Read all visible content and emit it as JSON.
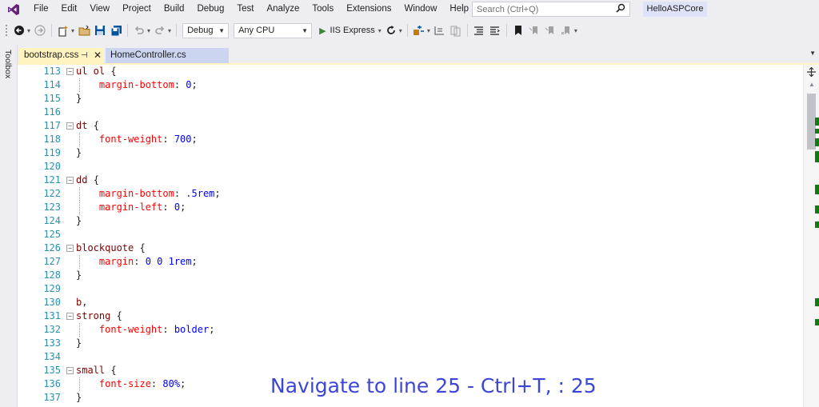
{
  "menu": {
    "items": [
      "File",
      "Edit",
      "View",
      "Project",
      "Build",
      "Debug",
      "Test",
      "Analyze",
      "Tools",
      "Extensions",
      "Window",
      "Help"
    ],
    "search_placeholder": "Search (Ctrl+Q)",
    "solution_name": "HelloASPCore"
  },
  "toolbar": {
    "config": "Debug",
    "platform": "Any CPU",
    "run_label": "IIS Express"
  },
  "toolbox": {
    "label": "Toolbox"
  },
  "tabs": [
    {
      "label": "bootstrap.css",
      "active": true
    },
    {
      "label": "HomeController.cs",
      "active": false
    }
  ],
  "editor": {
    "lines": [
      {
        "n": "113",
        "fold": true,
        "tokens": [
          [
            "sel",
            "ul ol "
          ],
          [
            "punc",
            "{"
          ]
        ]
      },
      {
        "n": "114",
        "guide": true,
        "tokens": [
          [
            "prop",
            "    margin-bottom"
          ],
          [
            "punc",
            ": "
          ],
          [
            "val",
            "0"
          ],
          [
            "punc",
            ";"
          ]
        ]
      },
      {
        "n": "115",
        "tokens": [
          [
            "punc",
            "}"
          ]
        ]
      },
      {
        "n": "116",
        "tokens": []
      },
      {
        "n": "117",
        "fold": true,
        "tokens": [
          [
            "sel",
            "dt "
          ],
          [
            "punc",
            "{"
          ]
        ]
      },
      {
        "n": "118",
        "guide": true,
        "tokens": [
          [
            "prop",
            "    font-weight"
          ],
          [
            "punc",
            ": "
          ],
          [
            "val",
            "700"
          ],
          [
            "punc",
            ";"
          ]
        ]
      },
      {
        "n": "119",
        "tokens": [
          [
            "punc",
            "}"
          ]
        ]
      },
      {
        "n": "120",
        "tokens": []
      },
      {
        "n": "121",
        "fold": true,
        "tokens": [
          [
            "sel",
            "dd "
          ],
          [
            "punc",
            "{"
          ]
        ]
      },
      {
        "n": "122",
        "guide": true,
        "tokens": [
          [
            "prop",
            "    margin-bottom"
          ],
          [
            "punc",
            ": "
          ],
          [
            "val",
            ".5rem"
          ],
          [
            "punc",
            ";"
          ]
        ]
      },
      {
        "n": "123",
        "guide": true,
        "tokens": [
          [
            "prop",
            "    margin-left"
          ],
          [
            "punc",
            ": "
          ],
          [
            "val",
            "0"
          ],
          [
            "punc",
            ";"
          ]
        ]
      },
      {
        "n": "124",
        "tokens": [
          [
            "punc",
            "}"
          ]
        ]
      },
      {
        "n": "125",
        "tokens": []
      },
      {
        "n": "126",
        "fold": true,
        "tokens": [
          [
            "sel",
            "blockquote "
          ],
          [
            "punc",
            "{"
          ]
        ]
      },
      {
        "n": "127",
        "guide": true,
        "tokens": [
          [
            "prop",
            "    margin"
          ],
          [
            "punc",
            ": "
          ],
          [
            "val",
            "0 0 1rem"
          ],
          [
            "punc",
            ";"
          ]
        ]
      },
      {
        "n": "128",
        "tokens": [
          [
            "punc",
            "}"
          ]
        ]
      },
      {
        "n": "129",
        "tokens": []
      },
      {
        "n": "130",
        "tokens": [
          [
            "sel",
            "b"
          ],
          [
            "punc",
            ","
          ]
        ]
      },
      {
        "n": "131",
        "fold": true,
        "tokens": [
          [
            "sel",
            "strong "
          ],
          [
            "punc",
            "{"
          ]
        ]
      },
      {
        "n": "132",
        "guide": true,
        "tokens": [
          [
            "prop",
            "    font-weight"
          ],
          [
            "punc",
            ": "
          ],
          [
            "val",
            "bolder"
          ],
          [
            "punc",
            ";"
          ]
        ]
      },
      {
        "n": "133",
        "tokens": [
          [
            "punc",
            "}"
          ]
        ]
      },
      {
        "n": "134",
        "tokens": []
      },
      {
        "n": "135",
        "fold": true,
        "tokens": [
          [
            "sel",
            "small "
          ],
          [
            "punc",
            "{"
          ]
        ]
      },
      {
        "n": "136",
        "guide": true,
        "tokens": [
          [
            "prop",
            "    font-size"
          ],
          [
            "punc",
            ": "
          ],
          [
            "val",
            "80%"
          ],
          [
            "punc",
            ";"
          ]
        ]
      },
      {
        "n": "137",
        "tokens": [
          [
            "punc",
            "}"
          ]
        ]
      }
    ]
  },
  "overlay": {
    "text": "Navigate to line 25 - Ctrl+T, : 25"
  },
  "icons": {
    "logo": "visual-studio-logo-icon",
    "search": "search-icon",
    "pin": "pin-icon",
    "close": "close-icon"
  },
  "colors": {
    "active_tab": "#fff3bf",
    "inactive_tab": "#ccd5f0",
    "selector": "#800000",
    "property": "#ff0000",
    "value": "#0000ff",
    "line_number": "#2b91af",
    "overlay_text": "#3c46d6",
    "change_marker": "#107c10"
  }
}
